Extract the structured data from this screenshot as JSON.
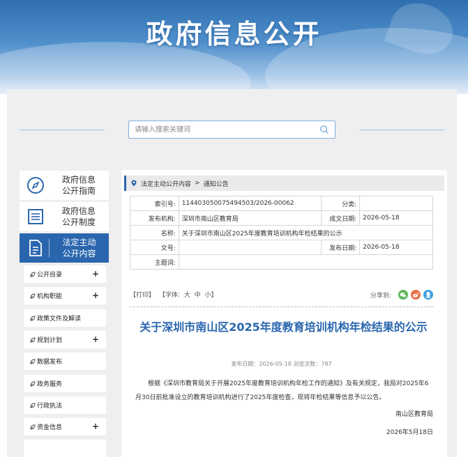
{
  "banner": {
    "title": "政府信息公开"
  },
  "search": {
    "placeholder": "请输入搜索关键词"
  },
  "sidebar": {
    "tiles": [
      {
        "line1": "政府信息",
        "line2": "公开指南",
        "icon": "compass-icon"
      },
      {
        "line1": "政府信息",
        "line2": "公开制度",
        "icon": "list-document-icon"
      },
      {
        "line1": "法定主动",
        "line2": "公开内容",
        "icon": "document-icon"
      }
    ],
    "menu": [
      {
        "label": "公开目录",
        "expand": "+"
      },
      {
        "label": "机构职能",
        "expand": "+"
      },
      {
        "label": "政策文件及解读",
        "expand": ""
      },
      {
        "label": "规划计划",
        "expand": "+"
      },
      {
        "label": "数据发布",
        "expand": ""
      },
      {
        "label": "政务服务",
        "expand": ""
      },
      {
        "label": "行政执法",
        "expand": ""
      },
      {
        "label": "资金信息",
        "expand": "+"
      }
    ]
  },
  "breadcrumb": {
    "root": "法定主动公开内容",
    "separator": ">",
    "current": "通知公告"
  },
  "meta": {
    "index_label": "索引号:",
    "index_value": "114403050075494503/2026-00062",
    "category_label": "分类:",
    "category_value": "",
    "publisher_label": "发布机构:",
    "publisher_value": "深圳市南山区教育局",
    "created_label": "成文日期:",
    "created_value": "2026-05-18",
    "name_label": "名称:",
    "name_value": "关于深圳市南山区2025年度教育培训机构年检结果的公示",
    "docno_label": "文号:",
    "docno_value": "",
    "pubdate_label": "发布日期:",
    "pubdate_value": "2026-05-18",
    "subject_label": "主题词:",
    "subject_value": ""
  },
  "tools": {
    "print": "【打印】",
    "font_label": "【字体:",
    "font_large": "大",
    "font_medium": "中",
    "font_small": "小】",
    "share_label": "分享到:"
  },
  "article": {
    "title": "关于深圳市南山区2025年度教育培训机构年检结果的公示",
    "info": "发布日期：2026-05-18 浏览次数：787",
    "body": "根据《深圳市教育局关于开展2025年度教育培训机构年检工作的通知》及有关规定，我局对2025年6月30日前批准设立的教育培训机构进行了2025年度检查，现将年检结果等信息予以公告。",
    "sign": "南山区教育局",
    "date": "2026年5月18日"
  },
  "colors": {
    "accent": "#2a66ae",
    "wechat": "#5cb85c",
    "weibo": "#e8704a",
    "qq": "#3fa0e0"
  }
}
